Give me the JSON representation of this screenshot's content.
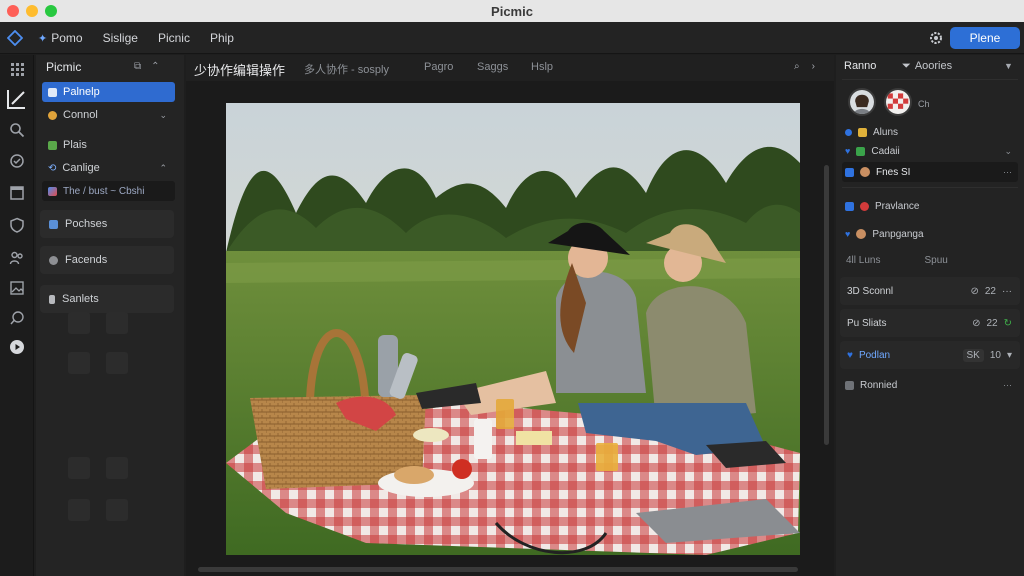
{
  "window": {
    "title": "Picmic"
  },
  "menu": {
    "items": [
      "Pomo",
      "Sislige",
      "Picnic",
      "Phip"
    ],
    "primary_button": "Plene"
  },
  "left_panel": {
    "title": "Picmic",
    "layers": [
      {
        "label": "Palnelp",
        "selected": true
      },
      {
        "label": "Connol",
        "expandable": true
      },
      {
        "label": "Plais"
      },
      {
        "label": "Canlige",
        "expandable": true
      },
      {
        "label": "The / bust ~ Cbshi"
      }
    ],
    "groups": [
      "Pochses",
      "Facends",
      "Sanlets"
    ]
  },
  "doc_tabs": {
    "active": "少协作编辑操作",
    "secondary": "多人协作 - sosply",
    "items": [
      "Pagro",
      "Saggs",
      "Hslp"
    ]
  },
  "canvas": {
    "image_alt": "Two women sitting on a red checkered picnic blanket in a grassy park with a wicker basket, thermos, food and drinks"
  },
  "right_panel": {
    "tabs": {
      "active": "Ranno",
      "other": "Aoories"
    },
    "avatars_extra": "Ch",
    "properties": [
      {
        "label": "Aluns",
        "color": "#2f72e0"
      },
      {
        "label": "Cadaii",
        "color": "#2f72e0"
      },
      {
        "label": "Fnes SI",
        "selected": true
      },
      {
        "label": "Pravlance"
      },
      {
        "label": "Panpganga"
      }
    ],
    "captions": [
      "4ll Luns",
      "Spuu"
    ],
    "cards": [
      {
        "label": "3D Sconnl",
        "value": "22"
      },
      {
        "label": "Pu Sliats",
        "value": "22"
      },
      {
        "label": "Podlan",
        "box": "SK",
        "value": "10"
      },
      {
        "label": "Ronnied"
      }
    ]
  },
  "colors": {
    "accent": "#2f6bd0",
    "primary_button": "#2d6fd6",
    "background": "#1e1e1e"
  }
}
